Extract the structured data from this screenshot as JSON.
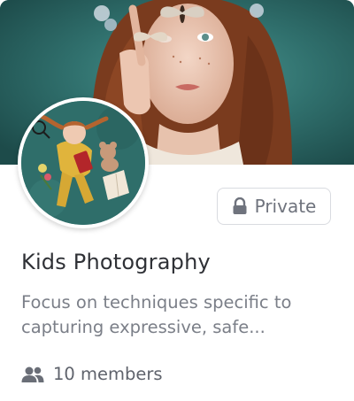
{
  "group": {
    "title": "Kids Photography",
    "description": "Focus on techniques specific to capturing expressive, safe...",
    "privacy_label": "Private",
    "members_label": "10 members"
  },
  "icons": {
    "privacy": "lock-icon",
    "members": "people-icon"
  },
  "colors": {
    "cover_teal": "#2e6f6c",
    "title_text": "#2f3136",
    "muted_text": "#7b7f88",
    "badge_border": "#d9dbe0"
  }
}
